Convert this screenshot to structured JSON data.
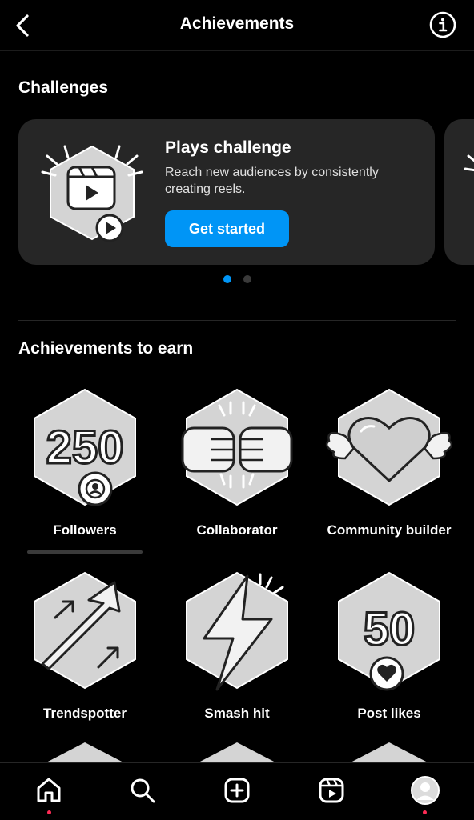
{
  "header": {
    "title": "Achievements"
  },
  "challenges": {
    "heading": "Challenges",
    "card": {
      "title": "Plays challenge",
      "description": "Reach new audiences by consistently creating reels.",
      "button_label": "Get started"
    },
    "pagination": {
      "total": 2,
      "active": 1
    }
  },
  "achievements": {
    "heading": "Achievements to earn",
    "items": [
      {
        "label": "Followers",
        "number": "250",
        "icon": "followers-badge-icon"
      },
      {
        "label": "Collaborator",
        "icon": "collaborator-badge-icon"
      },
      {
        "label": "Community builder",
        "icon": "community-builder-badge-icon"
      },
      {
        "label": "Trendspotter",
        "icon": "trendspotter-badge-icon"
      },
      {
        "label": "Smash hit",
        "icon": "smash-hit-badge-icon"
      },
      {
        "label": "Post likes",
        "number": "50",
        "icon": "post-likes-badge-icon"
      }
    ]
  },
  "colors": {
    "accent": "#0095f6",
    "card_bg": "#262626",
    "notification": "#ff2b55"
  }
}
